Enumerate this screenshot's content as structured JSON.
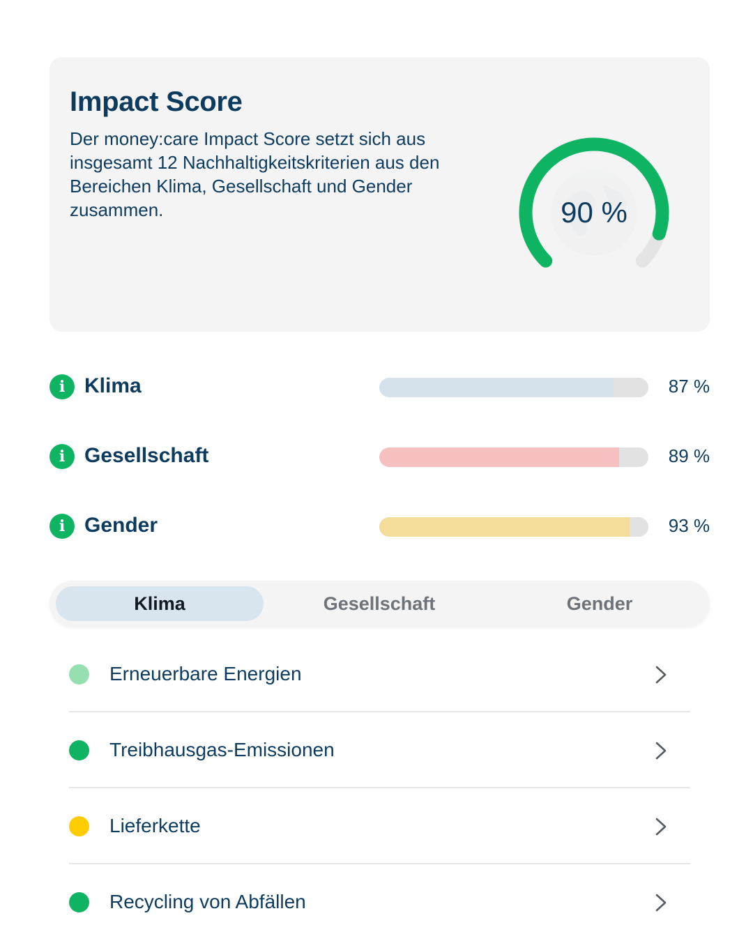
{
  "impact_score": {
    "title": "Impact Score",
    "description": "Der money:care Impact Score setzt sich aus insgesamt 12 Nachhaltigkeitskriterien aus den Bereichen Klima, Gesellschaft und Gender zusammen.",
    "value_label": "90 %",
    "value": 0.9,
    "gauge_color": "#0fb463",
    "gauge_track_color": "#e4e4e4"
  },
  "categories": [
    {
      "label": "Klima",
      "percent_label": "87 %",
      "value": 0.87,
      "color": "#d5e2ec"
    },
    {
      "label": "Gesellschaft",
      "percent_label": "89 %",
      "value": 0.89,
      "color": "#f6c0c0"
    },
    {
      "label": "Gender",
      "percent_label": "93 %",
      "value": 0.93,
      "color": "#f4dc9b"
    }
  ],
  "tabs": [
    {
      "label": "Klima",
      "active": true
    },
    {
      "label": "Gesellschaft",
      "active": false
    },
    {
      "label": "Gender",
      "active": false
    }
  ],
  "criteria": [
    {
      "label": "Erneuerbare Energien",
      "status_color": "#95dfb0"
    },
    {
      "label": "Treibhausgas-Emissionen",
      "status_color": "#0fb463"
    },
    {
      "label": "Lieferkette",
      "status_color": "#ffcc00"
    },
    {
      "label": "Recycling von Abfällen",
      "status_color": "#0fb463"
    }
  ],
  "icons": {
    "info": "info-icon",
    "chevron": "chevron-right-icon",
    "globe": "globe-icon"
  }
}
